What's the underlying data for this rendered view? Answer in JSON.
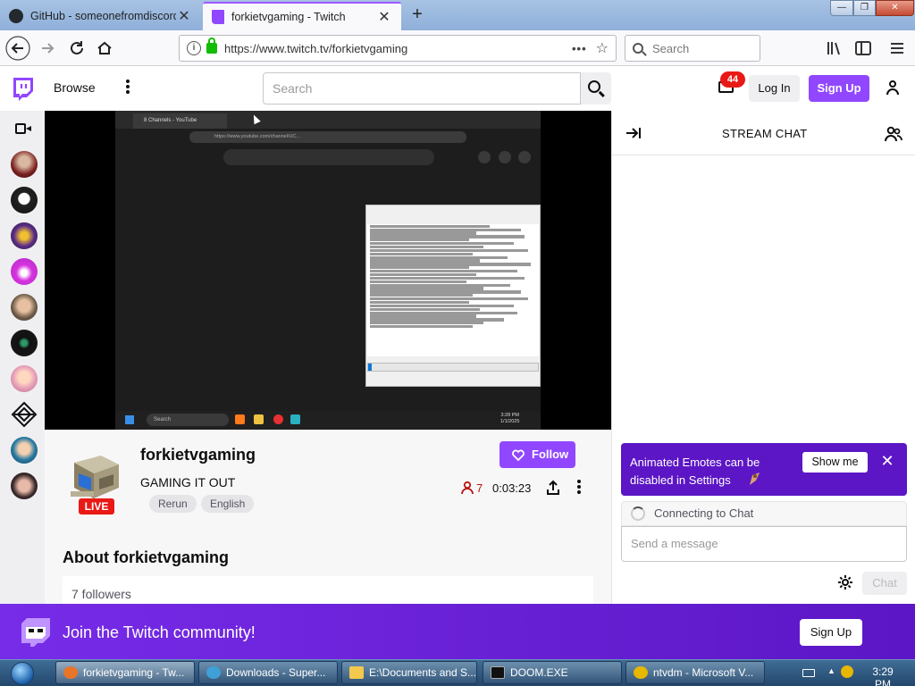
{
  "browser": {
    "tabs": [
      {
        "title": "GitHub - someonefromdiscord"
      },
      {
        "title": "forkietvgaming - Twitch"
      }
    ],
    "url": "https://www.twitch.tv/forkietvgaming",
    "search_placeholder": "Search"
  },
  "twitch_nav": {
    "browse_label": "Browse",
    "search_placeholder": "Search",
    "inbox_badge": "44",
    "login_label": "Log In",
    "signup_label": "Sign Up"
  },
  "video": {
    "screen_tab_title": "8 Channels - YouTube",
    "screen_url": "https://www.youtube.com/channel/UC...",
    "screen_search": "Search",
    "screen_clock": "3:28 PM\n1/1/2025"
  },
  "channel": {
    "name": "forkietvgaming",
    "title": "GAMING IT OUT",
    "live_label": "LIVE",
    "tags": [
      "Rerun",
      "English"
    ],
    "follow_label": "Follow",
    "viewers": "7",
    "uptime": "0:03:23",
    "about_heading": "About forkietvgaming",
    "followers": "7 followers"
  },
  "chat": {
    "title": "STREAM CHAT",
    "notice_text": "Animated Emotes can be disabled in Settings",
    "notice_button": "Show me",
    "connecting_text": "Connecting to Chat",
    "input_placeholder": "Send a message",
    "send_label": "Chat"
  },
  "banner": {
    "text": "Join the Twitch community!",
    "signup_label": "Sign Up"
  },
  "taskbar": {
    "items": [
      {
        "label": "forkietvgaming - Tw..."
      },
      {
        "label": "Downloads - Super..."
      },
      {
        "label": "E:\\Documents and S..."
      },
      {
        "label": "DOOM.EXE"
      },
      {
        "label": "ntvdm - Microsoft V..."
      }
    ],
    "clock": "3:29 PM"
  },
  "colors": {
    "twitch_purple": "#9147ff",
    "live_red": "#e91916",
    "notice_purple": "#5c16c5"
  }
}
